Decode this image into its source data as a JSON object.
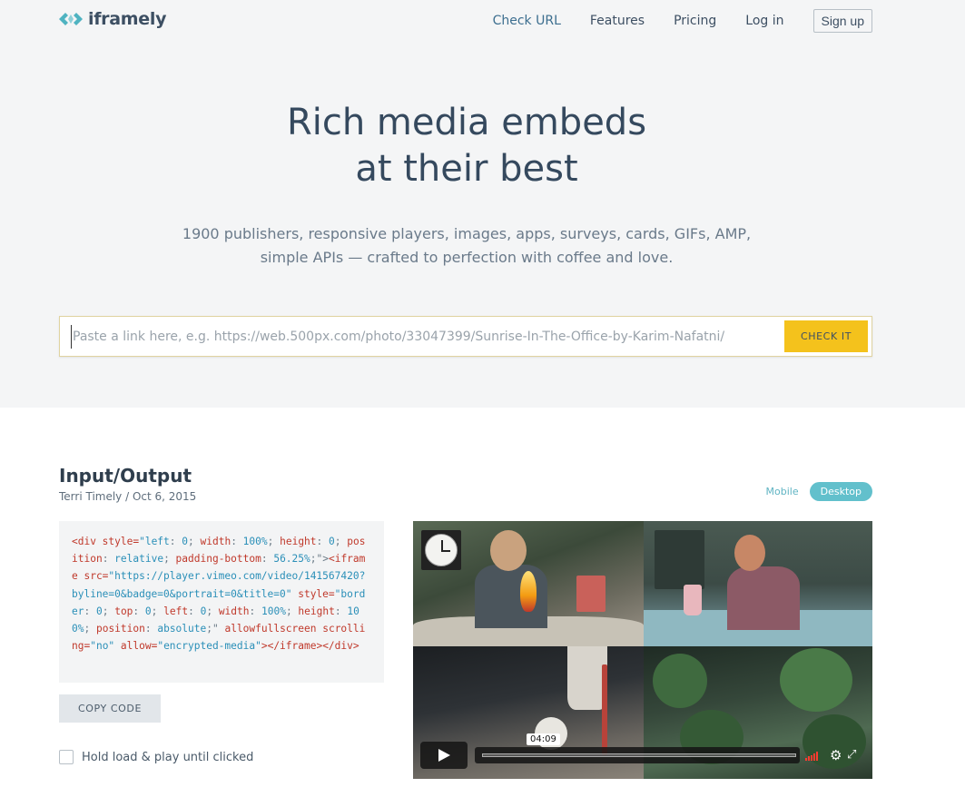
{
  "header": {
    "logo_text": "iframely",
    "nav": [
      {
        "label": "Check URL"
      },
      {
        "label": "Features"
      },
      {
        "label": "Pricing"
      },
      {
        "label": "Log in"
      }
    ],
    "signup_label": "Sign up"
  },
  "hero": {
    "headline_line1": "Rich media embeds",
    "headline_line2": "at their best",
    "subtitle_line1": "1900 publishers, responsive players, images, apps, surveys, cards, GIFs, AMP,",
    "subtitle_line2": "simple APIs — crafted to perfection with coffee and love."
  },
  "search": {
    "placeholder": "Paste a link here, e.g. https://web.500px.com/photo/33047399/Sunrise-In-The-Office-by-Karim-Nafatni/",
    "value": "",
    "button_label": "CHECK IT"
  },
  "example": {
    "title": "Input/Output",
    "meta": "Terri Timely / Oct 6, 2015",
    "toggle": {
      "mobile": "Mobile",
      "desktop": "Desktop",
      "selected": "Desktop"
    },
    "code_parts": [
      {
        "k": "t",
        "s": "<div style="
      },
      {
        "k": "v",
        "s": "\"left"
      },
      {
        "k": "p",
        "s": ": "
      },
      {
        "k": "v",
        "s": "0"
      },
      {
        "k": "p",
        "s": "; "
      },
      {
        "k": "t",
        "s": "width"
      },
      {
        "k": "p",
        "s": ": "
      },
      {
        "k": "v",
        "s": "100%"
      },
      {
        "k": "p",
        "s": "; "
      },
      {
        "k": "t",
        "s": "height"
      },
      {
        "k": "p",
        "s": ": "
      },
      {
        "k": "v",
        "s": "0"
      },
      {
        "k": "p",
        "s": "; "
      },
      {
        "k": "t",
        "s": "position"
      },
      {
        "k": "p",
        "s": ": "
      },
      {
        "k": "v",
        "s": "relative"
      },
      {
        "k": "p",
        "s": "; "
      },
      {
        "k": "t",
        "s": "padding-bottom"
      },
      {
        "k": "p",
        "s": ": "
      },
      {
        "k": "v",
        "s": "56.25%"
      },
      {
        "k": "p",
        "s": ";\">"
      },
      {
        "k": "t",
        "s": "<iframe src="
      },
      {
        "k": "v",
        "s": "\"https://player.vimeo.com/video/141567420?byline=0&badge=0&portrait=0&title=0\""
      },
      {
        "k": "t",
        "s": " style="
      },
      {
        "k": "v",
        "s": "\"border"
      },
      {
        "k": "p",
        "s": ": "
      },
      {
        "k": "v",
        "s": "0"
      },
      {
        "k": "p",
        "s": "; "
      },
      {
        "k": "t",
        "s": "top"
      },
      {
        "k": "p",
        "s": ": "
      },
      {
        "k": "v",
        "s": "0"
      },
      {
        "k": "p",
        "s": "; "
      },
      {
        "k": "t",
        "s": "left"
      },
      {
        "k": "p",
        "s": ": "
      },
      {
        "k": "v",
        "s": "0"
      },
      {
        "k": "p",
        "s": "; "
      },
      {
        "k": "t",
        "s": "width"
      },
      {
        "k": "p",
        "s": ": "
      },
      {
        "k": "v",
        "s": "100%"
      },
      {
        "k": "p",
        "s": "; "
      },
      {
        "k": "t",
        "s": "height"
      },
      {
        "k": "p",
        "s": ": "
      },
      {
        "k": "v",
        "s": "100%"
      },
      {
        "k": "p",
        "s": "; "
      },
      {
        "k": "t",
        "s": "position"
      },
      {
        "k": "p",
        "s": ": "
      },
      {
        "k": "v",
        "s": "absolute"
      },
      {
        "k": "p",
        "s": ";\" "
      },
      {
        "k": "t",
        "s": "allowfullscreen scrolling="
      },
      {
        "k": "v",
        "s": "\"no\""
      },
      {
        "k": "t",
        "s": " allow="
      },
      {
        "k": "v",
        "s": "\"encrypted-media\""
      },
      {
        "k": "t",
        "s": "></iframe></div>"
      }
    ],
    "copy_label": "COPY CODE",
    "checkbox_label": "Hold load & play until clicked",
    "checkbox_checked": false
  },
  "video": {
    "time": "04:09",
    "icons": [
      "play-icon",
      "volume-icon",
      "gear-icon",
      "fullscreen-icon"
    ]
  },
  "colors": {
    "accent_yellow": "#f4c21c",
    "accent_teal": "#62c0cc",
    "text_dark": "#35495e"
  }
}
